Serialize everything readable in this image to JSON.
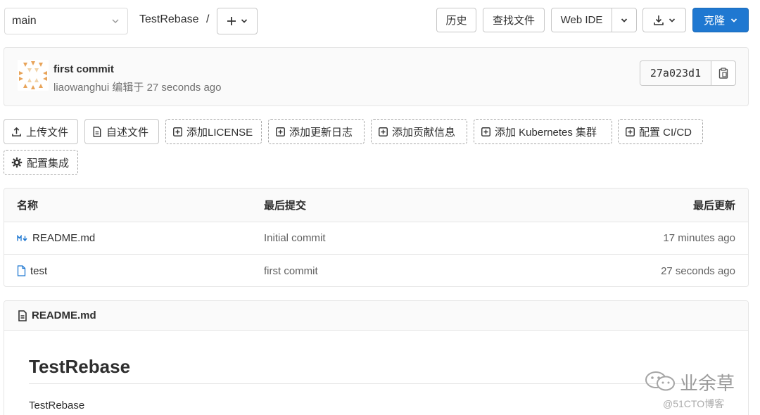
{
  "topbar": {
    "branch": "main",
    "breadcrumb_project": "TestRebase",
    "breadcrumb_sep": "/",
    "history_label": "历史",
    "find_file_label": "查找文件",
    "web_ide_label": "Web IDE",
    "clone_label": "克隆",
    "clone_color": "#1f78d1"
  },
  "commit": {
    "title": "first commit",
    "author": "liaowanghui",
    "meta_text": "编辑于 27 seconds ago",
    "sha": "27a023d1"
  },
  "actions": {
    "upload": "上传文件",
    "readme": "自述文件",
    "add_license": "添加LICENSE",
    "add_changelog": "添加更新日志",
    "add_contributing": "添加贡献信息",
    "add_k8s": "添加 Kubernetes 集群",
    "setup_cicd": "配置 CI/CD",
    "integrations": "配置集成"
  },
  "files": {
    "headers": {
      "name": "名称",
      "last_commit": "最后提交",
      "last_update": "最后更新"
    },
    "rows": [
      {
        "icon": "markdown-icon",
        "name": "README.md",
        "commit": "Initial commit",
        "updated": "17 minutes ago"
      },
      {
        "icon": "file-icon",
        "name": "test",
        "commit": "first commit",
        "updated": "27 seconds ago"
      }
    ]
  },
  "readme": {
    "filename": "README.md",
    "heading": "TestRebase",
    "body": "TestRebase"
  },
  "watermark": {
    "name": "业余草",
    "site": "@51CTO博客"
  }
}
